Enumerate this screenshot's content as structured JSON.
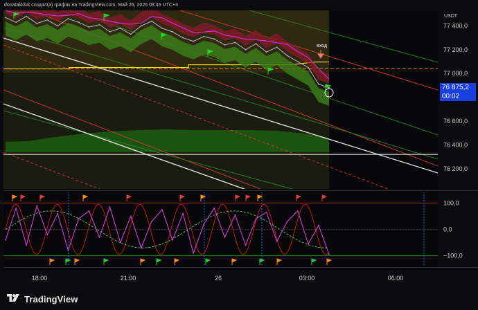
{
  "header": {
    "caption": "donatakkluk создал(а) график на TradingView.com, Май 26, 2026 03:45 UTC+3"
  },
  "price_axis": {
    "unit": "USDT",
    "current_price": "76 875,2",
    "countdown": "00:02"
  },
  "brand": {
    "name": "TradingView",
    "logo_icon": "tradingview-logo-icon"
  },
  "annotations": {
    "entry_label": "вход"
  },
  "colors": {
    "upper_band": "#8a1a2a",
    "lower_band": "#3a7a1a",
    "price": "#b8b8c8",
    "level": "#ffe600",
    "red_line": "#e23b3b",
    "green_line": "#2d8a2d",
    "white_line": "#ffffff",
    "oscillator": "#d040d0",
    "osc_cycle": "#c21818",
    "marker_blue": "#2962ff"
  },
  "chart_data": [
    {
      "type": "line",
      "title": "",
      "ylabel": "USDT",
      "x_ticks": [
        "18:00",
        "21:00",
        "26",
        "03:00",
        "06:00"
      ],
      "y_ticks": [
        76200,
        76400,
        76600,
        76800,
        77000,
        77200,
        77400
      ],
      "y_tick_labels": [
        "76 200,0",
        "76 400,0",
        "76 600,0",
        "76 800,0",
        "77 000,0",
        "77 200,0",
        "77 400,0"
      ],
      "ylim": [
        76030,
        77530
      ],
      "grid": false,
      "current_price": 76875.2,
      "levels": [
        {
          "name": "yellow-level",
          "value": 77050
        },
        {
          "name": "dashed-level",
          "value": 77040
        },
        {
          "name": "white-level",
          "value": 76320
        }
      ],
      "series": [
        {
          "values": [
            77470,
            77430,
            77480,
            77420,
            77450,
            77400,
            77460,
            77430,
            77390,
            77410,
            77350,
            77380,
            77330,
            77400,
            77440,
            77380,
            77350,
            77300,
            77270,
            77310,
            77290,
            77240,
            77260,
            77200,
            77250,
            77180,
            77220,
            77150,
            77100,
            77050,
            76910,
            76880
          ]
        }
      ]
    },
    {
      "type": "line",
      "title": "",
      "y_ticks": [
        100,
        0,
        -100
      ],
      "y_tick_labels": [
        "100,0",
        "0,0",
        "−100,0"
      ],
      "ylim": [
        -135,
        135
      ],
      "series": [
        {
          "values": [
            -40,
            80,
            -60,
            90,
            -20,
            60,
            -80,
            40,
            70,
            -30,
            85,
            -50,
            50,
            -70,
            30,
            75,
            -40,
            60,
            -90,
            20,
            80,
            -30,
            55,
            -60,
            40,
            65,
            -45,
            30,
            70,
            -55,
            15,
            -95
          ]
        }
      ]
    }
  ]
}
